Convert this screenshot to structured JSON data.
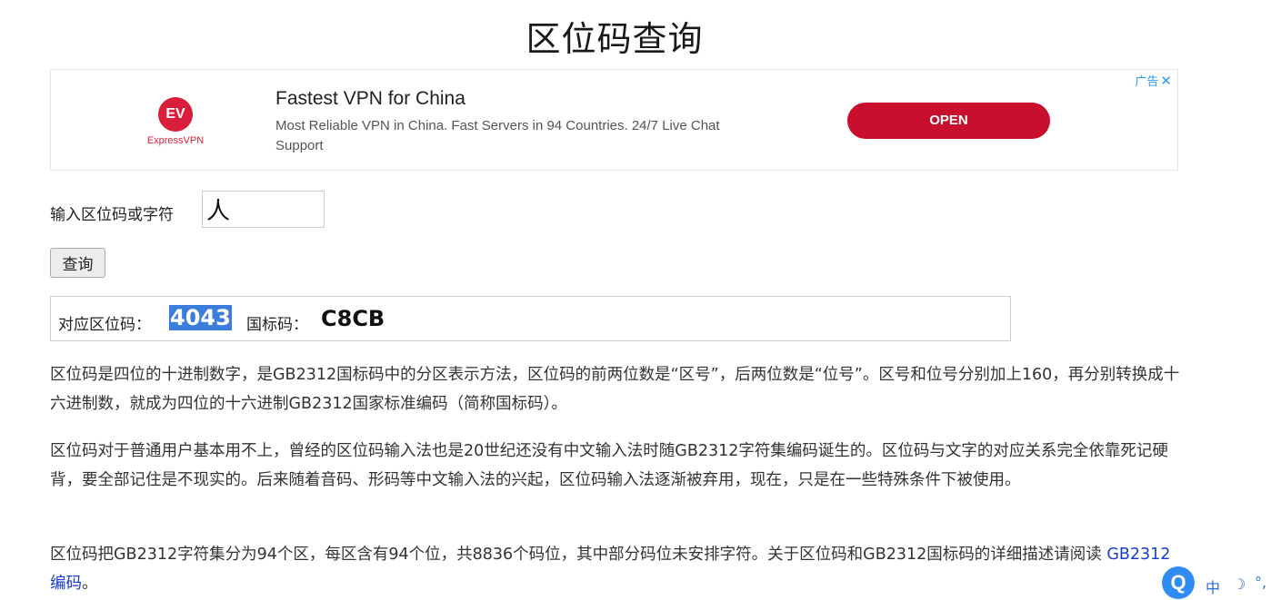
{
  "page": {
    "title": "区位码查询"
  },
  "ad": {
    "logo_text": "ExpressVPN",
    "logo_mark": "EV",
    "headline": "Fastest VPN for China",
    "description": "Most Reliable VPN in China. Fast Servers in 94 Countries. 24/7 Live Chat Support",
    "button": "OPEN",
    "badge": "广告",
    "close": "✕"
  },
  "form": {
    "label": "输入区位码或字符",
    "value": "人",
    "button": "查询"
  },
  "result": {
    "quwei_label": "对应区位码：",
    "quwei_value": "4043",
    "gb_label": "国标码：",
    "gb_value": "C8CB"
  },
  "content": {
    "p1": "区位码是四位的十进制数字，是GB2312国标码中的分区表示方法，区位码的前两位数是“区号”，后两位数是“位号”。区号和位号分别加上160，再分别转换成十六进制数，就成为四位的十六进制GB2312国家标准编码（简称国标码）。",
    "p2": "区位码对于普通用户基本用不上，曾经的区位码输入法也是20世纪还没有中文输入法时随GB2312字符集编码诞生的。区位码与文字的对应关系完全依靠死记硬背，要全部记住是不现实的。后来随着音码、形码等中文输入法的兴起，区位码输入法逐渐被弃用，现在，只是在一些特殊条件下被使用。",
    "p3_text": "区位码把GB2312字符集分为94个区，每区含有94个位，共8836个码位，其中部分码位未安排字符。关于区位码和GB2312国标码的详细描述请阅读 ",
    "p3_link": "GB2312 编码",
    "p3_end": "。"
  },
  "ime": {
    "logo": "Q",
    "mode": "中",
    "moon": "☽",
    "dots": "°,"
  }
}
